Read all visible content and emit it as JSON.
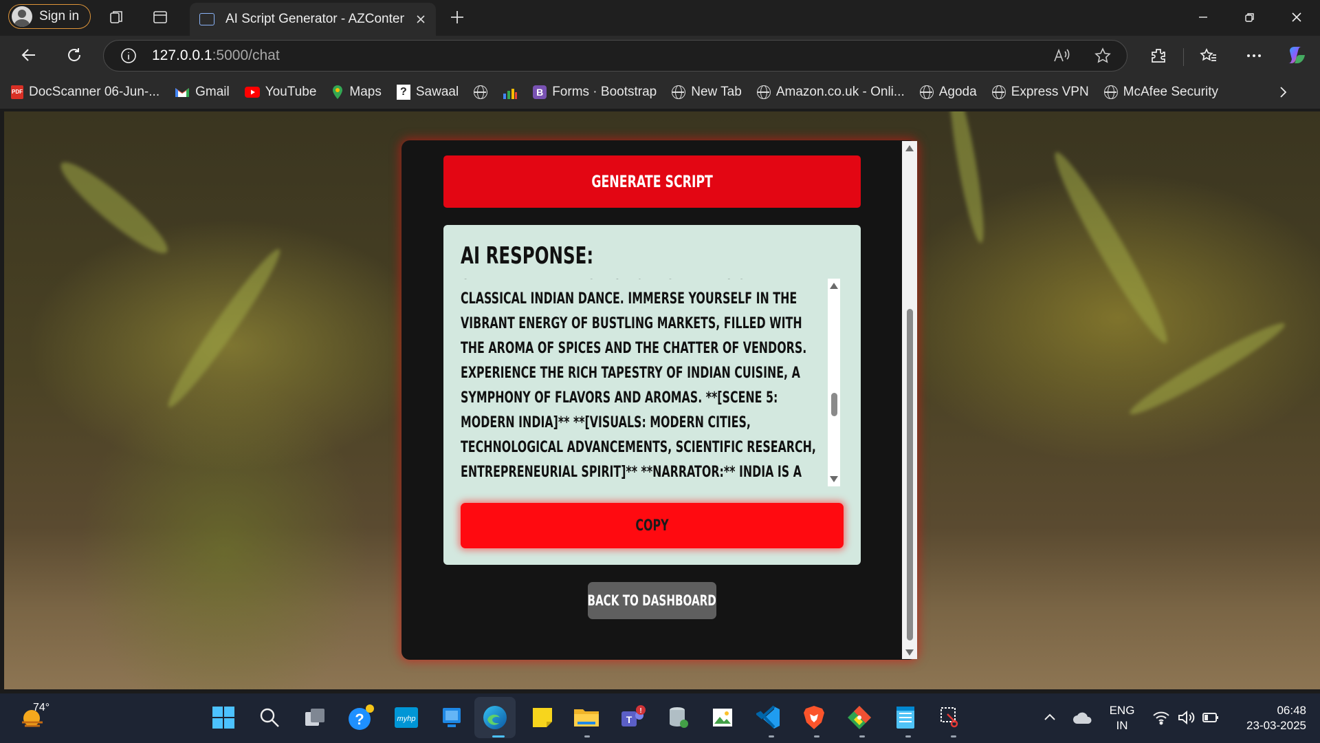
{
  "browser": {
    "signin_label": "Sign in",
    "tab_title": "AI Script Generator - AZContent",
    "url_host": "127.0.0.1",
    "url_path": ":5000/chat",
    "bookmarks": [
      {
        "label": "DocScanner 06-Jun-...",
        "icon": "pdf-icon"
      },
      {
        "label": "Gmail",
        "icon": "gmail-icon"
      },
      {
        "label": "YouTube",
        "icon": "youtube-icon"
      },
      {
        "label": "Maps",
        "icon": "maps-icon"
      },
      {
        "label": "Sawaal",
        "icon": "sawaal-icon"
      },
      {
        "label": "",
        "icon": "globe-icon"
      },
      {
        "label": "",
        "icon": "chart-icon"
      },
      {
        "label": "Forms · Bootstrap",
        "icon": "bootstrap-icon"
      },
      {
        "label": "New Tab",
        "icon": "globe-icon"
      },
      {
        "label": "Amazon.co.uk - Onli...",
        "icon": "globe-icon"
      },
      {
        "label": "Agoda",
        "icon": "globe-icon"
      },
      {
        "label": "Express VPN",
        "icon": "globe-icon"
      },
      {
        "label": "McAfee Security",
        "icon": "globe-icon"
      }
    ]
  },
  "page": {
    "generate_label": "GENERATE SCRIPT",
    "response_title": "AI RESPONSE:",
    "response_text": "captivated by the graceful movements of classical Indian dance. Immerse yourself in the vibrant energy of bustling markets, filled with the aroma of spices and the chatter of vendors. Experience the rich tapestry of Indian cuisine, a symphony of flavors and aromas. **[Scene 5: Modern India]** **[Visuals: Modern cities, technological advancements, scientific research, entrepreneurial spirit]** **Narrator:** India is a nation on the rise, a global powerhouse in technology, science, and innovation. Witness the dynamism of its modern cities, bustling with energy",
    "copy_label": "COPY",
    "back_label": "BACK TO DASHBOARD"
  },
  "taskbar": {
    "weather_temp": "74°",
    "lang_top": "ENG",
    "lang_bottom": "IN",
    "time": "06:48",
    "date": "23-03-2025"
  },
  "colors": {
    "primary_red": "#e30613",
    "copy_red": "#ff0a10",
    "panel_mint": "#d3e8df",
    "card_dark": "#141414"
  }
}
